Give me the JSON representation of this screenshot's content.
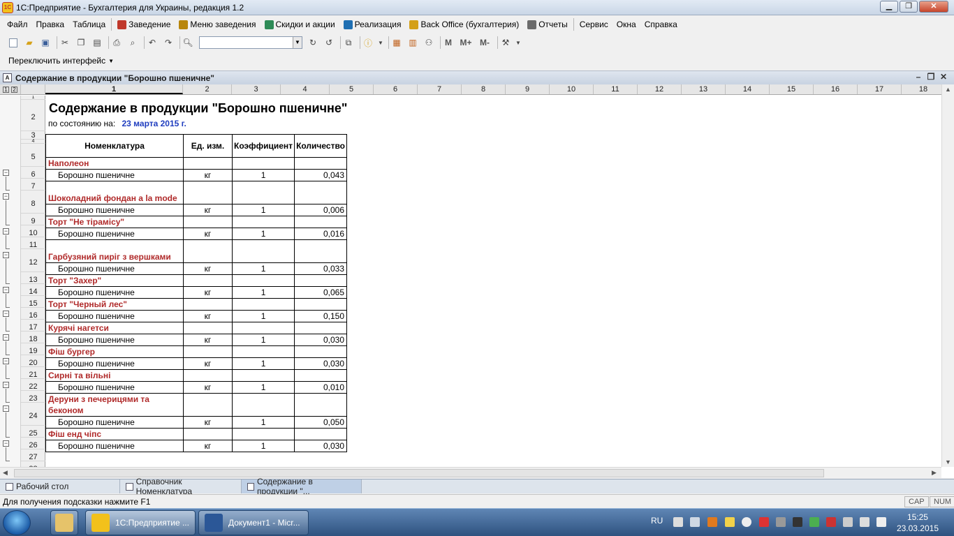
{
  "window": {
    "title": "1С:Предприятие - Бухгалтерия для Украины, редакция 1.2"
  },
  "menu": [
    {
      "label": "Файл",
      "icon": ""
    },
    {
      "label": "Правка",
      "icon": ""
    },
    {
      "label": "Таблица",
      "icon": ""
    },
    {
      "label": "Заведение",
      "icon": "restaurant-icon"
    },
    {
      "label": "Меню заведения",
      "icon": "menu-book-icon"
    },
    {
      "label": "Скидки и акции",
      "icon": "discount-icon"
    },
    {
      "label": "Реализация",
      "icon": "sales-icon"
    },
    {
      "label": "Back Office (бухгалтерия)",
      "icon": "backoffice-icon"
    },
    {
      "label": "Отчеты",
      "icon": "reports-icon"
    },
    {
      "label": "Сервис",
      "icon": ""
    },
    {
      "label": "Окна",
      "icon": ""
    },
    {
      "label": "Справка",
      "icon": ""
    }
  ],
  "toolbar": {
    "search_value": "",
    "m_label": "M",
    "mplus_label": "M+",
    "mminus_label": "M-"
  },
  "interface_switch": {
    "label": "Переключить интерфейс"
  },
  "document": {
    "title": "Содержание в продукции \"Борошно пшеничне\"",
    "column_headers": [
      "1",
      "2",
      "3",
      "4",
      "5",
      "6",
      "7",
      "8",
      "9",
      "10",
      "11",
      "12",
      "13",
      "14",
      "15",
      "16",
      "17",
      "18"
    ],
    "outline_levels": [
      "1",
      "2"
    ]
  },
  "report": {
    "heading": "Содержание в продукции \"Борошно пшеничне\"",
    "state_label": "по состоянию на:",
    "state_date": "23 марта 2015 г.",
    "table_headers": {
      "nomenclature": "Номенклатура",
      "unit": "Ед. изм.",
      "coef": "Коэффициент",
      "qty": "Количество"
    },
    "groups": [
      {
        "name": "Наполеон",
        "item": "Борошно пшеничне",
        "unit": "кг",
        "coef": "1",
        "qty": "0,043"
      },
      {
        "name": "Шоколадний фондан a la mode",
        "item": "Борошно пшеничне",
        "unit": "кг",
        "coef": "1",
        "qty": "0,006"
      },
      {
        "name": "Торт \"Не тірамісу\"",
        "item": "Борошно пшеничне",
        "unit": "кг",
        "coef": "1",
        "qty": "0,016"
      },
      {
        "name": "Гарбузяний пиріг з вершками",
        "item": "Борошно пшеничне",
        "unit": "кг",
        "coef": "1",
        "qty": "0,033"
      },
      {
        "name": "Торт \"Захер\"",
        "item": "Борошно пшеничне",
        "unit": "кг",
        "coef": "1",
        "qty": "0,065"
      },
      {
        "name": "Торт \"Черный лес\"",
        "item": "Борошно пшеничне",
        "unit": "кг",
        "coef": "1",
        "qty": "0,150"
      },
      {
        "name": "Курячі нагетси",
        "item": "Борошно пшеничне",
        "unit": "кг",
        "coef": "1",
        "qty": "0,030"
      },
      {
        "name": "Фіш бургер",
        "item": "Борошно пшеничне",
        "unit": "кг",
        "coef": "1",
        "qty": "0,030"
      },
      {
        "name": "Сирні та вільні",
        "item": "Борошно пшеничне",
        "unit": "кг",
        "coef": "1",
        "qty": "0,010"
      },
      {
        "name": "Деруни з печерицями та беконом",
        "item": "Борошно пшеничне",
        "unit": "кг",
        "coef": "1",
        "qty": "0,050"
      },
      {
        "name": "Фіш енд чіпс",
        "item": "Борошно пшеничне",
        "unit": "кг",
        "coef": "1",
        "qty": "0,030"
      }
    ]
  },
  "window_tabs": [
    {
      "label": "Рабочий стол",
      "active": false
    },
    {
      "label": "Справочник  Номенклатура",
      "active": false
    },
    {
      "label": "Содержание в продукции \"...",
      "active": true
    }
  ],
  "status": {
    "hint": "Для получения подсказки нажмите F1",
    "cap": "CAP",
    "num": "NUM"
  },
  "taskbar": {
    "buttons": [
      {
        "label": "1С:Предприятие ..."
      },
      {
        "label": "Документ1 - Micr..."
      }
    ],
    "language": "RU",
    "time": "15:25",
    "date": "23.03.2015"
  },
  "colors": {
    "group_text": "#b02a2a",
    "date_text": "#1f3dbf",
    "accent": "#2e527f"
  }
}
